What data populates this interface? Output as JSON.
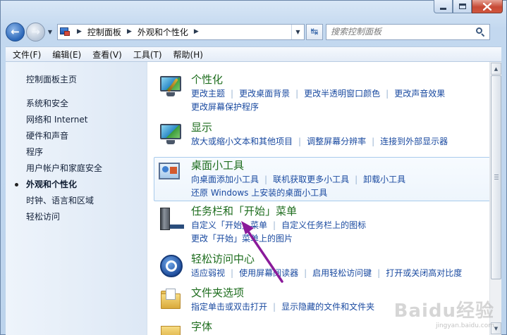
{
  "window": {
    "caption_buttons": [
      "minimize",
      "maximize",
      "close"
    ]
  },
  "address_bar": {
    "breadcrumbs": [
      "控制面板",
      "外观和个性化"
    ],
    "search_placeholder": "搜索控制面板"
  },
  "menu": {
    "items": [
      "文件(F)",
      "编辑(E)",
      "查看(V)",
      "工具(T)",
      "帮助(H)"
    ]
  },
  "sidebar": {
    "home": "控制面板主页",
    "items": [
      {
        "label": "系统和安全",
        "active": false
      },
      {
        "label": "网络和 Internet",
        "active": false
      },
      {
        "label": "硬件和声音",
        "active": false
      },
      {
        "label": "程序",
        "active": false
      },
      {
        "label": "用户帐户和家庭安全",
        "active": false
      },
      {
        "label": "外观和个性化",
        "active": true
      },
      {
        "label": "时钟、语言和区域",
        "active": false
      },
      {
        "label": "轻松访问",
        "active": false
      }
    ]
  },
  "categories": [
    {
      "title": "个性化",
      "icon": "personalization-icon",
      "links": [
        [
          "更改主题",
          "更改桌面背景",
          "更改半透明窗口颜色",
          "更改声音效果"
        ],
        [
          "更改屏幕保护程序"
        ]
      ]
    },
    {
      "title": "显示",
      "icon": "display-icon",
      "links": [
        [
          "放大或缩小文本和其他项目",
          "调整屏幕分辨率",
          "连接到外部显示器"
        ]
      ]
    },
    {
      "title": "桌面小工具",
      "icon": "gadgets-icon",
      "links": [
        [
          "向桌面添加小工具",
          "联机获取更多小工具",
          "卸载小工具"
        ],
        [
          "还原 Windows 上安装的桌面小工具"
        ]
      ]
    },
    {
      "title": "任务栏和「开始」菜单",
      "icon": "taskbar-icon",
      "links": [
        [
          "自定义「开始」菜单",
          "自定义任务栏上的图标"
        ],
        [
          "更改「开始」菜单上的图片"
        ]
      ]
    },
    {
      "title": "轻松访问中心",
      "icon": "ease-of-access-icon",
      "links": [
        [
          "适应弱视",
          "使用屏幕阅读器",
          "启用轻松访问键",
          "打开或关闭高对比度"
        ]
      ]
    },
    {
      "title": "文件夹选项",
      "icon": "folder-options-icon",
      "links": [
        [
          "指定单击或双击打开",
          "显示隐藏的文件和文件夹"
        ]
      ]
    },
    {
      "title": "字体",
      "icon": "fonts-icon",
      "links": []
    }
  ],
  "watermark": {
    "text": "Baidu经验",
    "sub": "jingyan.baidu.com"
  },
  "colors": {
    "category_title": "#1e6d1e",
    "link": "#1a4aa0",
    "annotation_arrow": "#8a1a9a"
  }
}
